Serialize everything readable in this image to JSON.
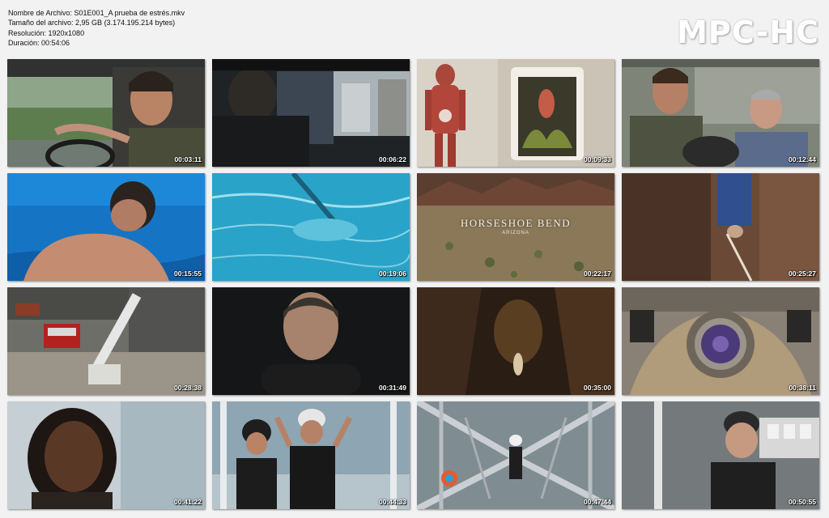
{
  "file_info": {
    "name_line": "Nombre de Archivo: S01E001_A prueba de estrés.mkv",
    "size_line": "Tamaño del archivo: 2,95 GB (3.174.195.214 bytes)",
    "resolution_line": "Resolución: 1920x1080",
    "duration_line": "Duración: 00:54:06"
  },
  "logo": {
    "text": "MPC-HC"
  },
  "thumbnails": [
    {
      "timestamp": "00:03:11"
    },
    {
      "timestamp": "00:06:22"
    },
    {
      "timestamp": "00:09:33"
    },
    {
      "timestamp": "00:12:44"
    },
    {
      "timestamp": "00:15:55"
    },
    {
      "timestamp": "00:19:06"
    },
    {
      "timestamp": "00:22:17",
      "title": "HORSESHOE BEND",
      "subtitle": "ARIZONA"
    },
    {
      "timestamp": "00:25:27"
    },
    {
      "timestamp": "00:28:38"
    },
    {
      "timestamp": "00:31:49"
    },
    {
      "timestamp": "00:35:00"
    },
    {
      "timestamp": "00:38:11"
    },
    {
      "timestamp": "00:41:22"
    },
    {
      "timestamp": "00:44:33"
    },
    {
      "timestamp": "00:47:44"
    },
    {
      "timestamp": "00:50:55"
    }
  ]
}
